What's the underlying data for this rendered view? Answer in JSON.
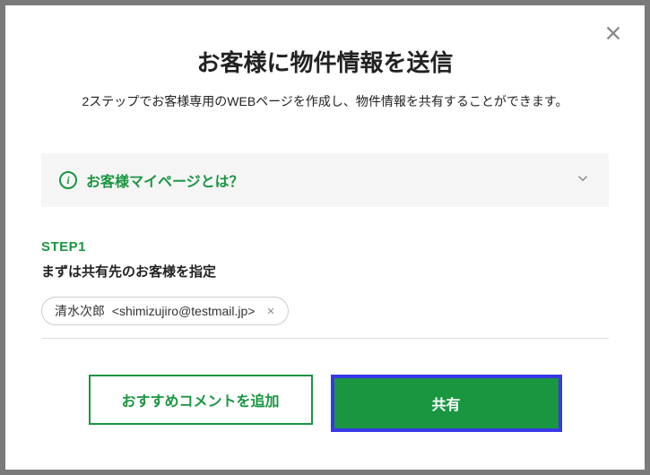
{
  "modal": {
    "title": "お客様に物件情報を送信",
    "subtitle": "2ステップでお客様専用のWEBページを作成し、物件情報を共有することができます。"
  },
  "accordion": {
    "label": "お客様マイページとは？"
  },
  "step": {
    "label": "STEP1",
    "instruction": "まずは共有先のお客様を指定"
  },
  "chip": {
    "name": "清水次郎",
    "email": "<shimizujiro@testmail.jp>"
  },
  "buttons": {
    "secondary": "おすすめコメントを追加",
    "primary": "共有"
  }
}
